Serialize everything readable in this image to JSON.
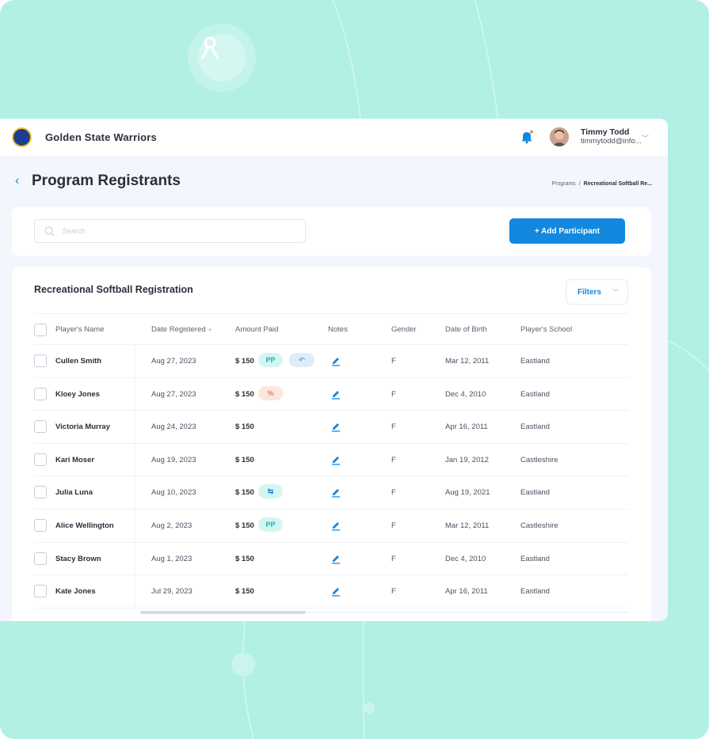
{
  "app": {
    "org_name": "Golden State Warriors",
    "user": {
      "name": "Timmy Todd",
      "email": "timmytodd@info..."
    }
  },
  "page": {
    "title": "Program Registrants",
    "breadcrumb": {
      "parent": "Programs",
      "separator": "/",
      "current": "Recreational Softball Re..."
    }
  },
  "search": {
    "placeholder": "Search",
    "value": ""
  },
  "actions": {
    "add_participant": "+ Add Participant"
  },
  "table": {
    "title": "Recreational Softball Registration",
    "filters_label": "Filters",
    "columns": [
      "Player's Name",
      "Date Registered",
      "Amount Paid",
      "Notes",
      "Gender",
      "Date of Birth",
      "Player's School"
    ],
    "rows": [
      {
        "name": "Cullen Smith",
        "date": "Aug 27, 2023",
        "amount": "$ 150",
        "badges": [
          "pp",
          "refund"
        ],
        "gender": "F",
        "dob": "Mar 12, 2011",
        "school": "Eastland"
      },
      {
        "name": "Kloey Jones",
        "date": "Aug 27, 2023",
        "amount": "$ 150",
        "badges": [
          "partial"
        ],
        "gender": "F",
        "dob": "Dec 4, 2010",
        "school": "Eastland"
      },
      {
        "name": "Victoria Murray",
        "date": "Aug 24, 2023",
        "amount": "$ 150",
        "badges": [],
        "gender": "F",
        "dob": "Apr 16, 2011",
        "school": "Eastland"
      },
      {
        "name": "Kari Moser",
        "date": "Aug 19, 2023",
        "amount": "$ 150",
        "badges": [],
        "gender": "F",
        "dob": "Jan 19, 2012",
        "school": "Castleshire"
      },
      {
        "name": "Julia Luna",
        "date": "Aug 10, 2023",
        "amount": "$ 150",
        "badges": [
          "card"
        ],
        "gender": "F",
        "dob": "Aug 19, 2021",
        "school": "Eastland"
      },
      {
        "name": "Alice Wellington",
        "date": "Aug 2, 2023",
        "amount": "$ 150",
        "badges": [
          "pp"
        ],
        "gender": "F",
        "dob": "Mar 12, 2011",
        "school": "Castleshire"
      },
      {
        "name": "Stacy Brown",
        "date": "Aug 1, 2023",
        "amount": "$ 150",
        "badges": [],
        "gender": "F",
        "dob": "Dec 4, 2010",
        "school": "Eastland"
      },
      {
        "name": "Kate Jones",
        "date": "Jul 29, 2023",
        "amount": "$ 150",
        "badges": [],
        "gender": "F",
        "dob": "Apr 16, 2011",
        "school": "Eastland"
      }
    ],
    "badge_labels": {
      "pp": "PP",
      "refund": "↶",
      "partial": "%",
      "card": "⇆"
    }
  },
  "colors": {
    "accent": "#1289de",
    "background": "#b2f0e6",
    "pp": "#17b7a7",
    "partial": "#e8845f"
  },
  "icons": [
    "back-icon",
    "bell-icon",
    "search-icon",
    "chevron-down-icon",
    "edit-icon",
    "sort-icon"
  ]
}
